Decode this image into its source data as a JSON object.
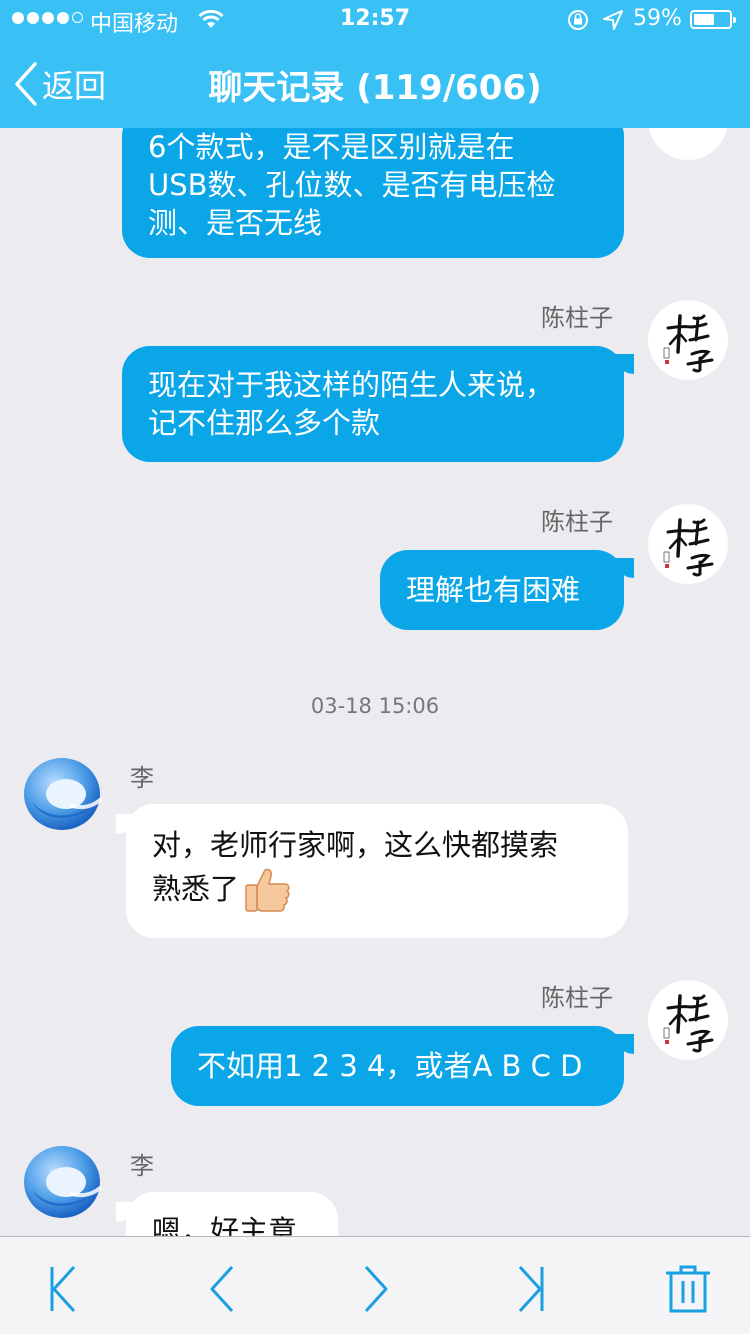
{
  "status_bar": {
    "carrier": "中国移动",
    "time": "12:57",
    "battery_percent": "59%",
    "battery_level": 0.59
  },
  "nav": {
    "back_label": "返回",
    "title": "聊天记录 (119/606)"
  },
  "messages": [
    {
      "sender": "",
      "side": "out",
      "text_lines": [
        "6个款式，是不是区别就是在",
        "USB数、孔位数、是否有电压检",
        "测、是否无线"
      ]
    },
    {
      "sender": "陈柱子",
      "side": "out",
      "text_lines": [
        "现在对于我这样的陌生人来说，",
        "记不住那么多个款"
      ]
    },
    {
      "sender": "陈柱子",
      "side": "out",
      "text_lines": [
        "理解也有困难"
      ]
    },
    {
      "timestamp": "03-18 15:06"
    },
    {
      "sender": "李",
      "side": "in",
      "text_lines": [
        "对，老师行家啊，这么快都摸索",
        "熟悉了"
      ],
      "emoji": "thumbs-up"
    },
    {
      "sender": "陈柱子",
      "side": "out",
      "text_lines": [
        "不如用1 2 3 4，或者A B C D"
      ]
    },
    {
      "sender": "李",
      "side": "in",
      "text_lines": [
        "嗯，好主意"
      ]
    }
  ],
  "avatar_zhu": {
    "calligraphy": "柱子",
    "seal": "肖像"
  },
  "toolbar": {
    "icons": [
      "first-page-icon",
      "previous-page-icon",
      "next-page-icon",
      "last-page-icon",
      "trash-icon"
    ]
  },
  "colors": {
    "nav_bg": "#39c0f5",
    "out_bubble": "#0aa6e8",
    "in_bubble": "#ffffff",
    "chat_bg": "#ebebf0",
    "toolbar_icon": "#1a9fe0"
  }
}
